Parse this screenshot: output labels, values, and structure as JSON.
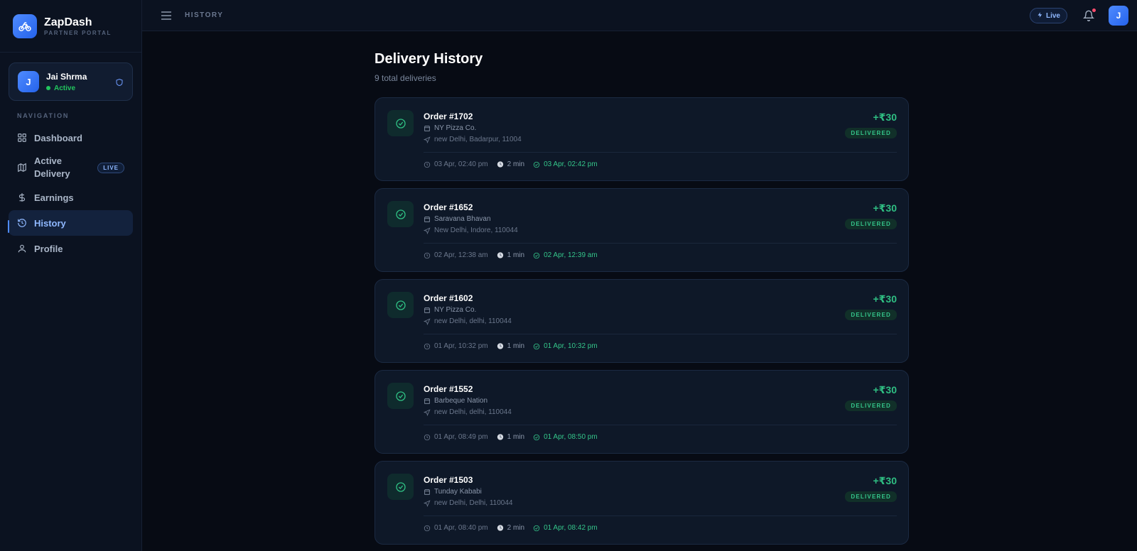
{
  "brand": {
    "name": "ZapDash",
    "subtitle": "PARTNER PORTAL"
  },
  "user": {
    "initial": "J",
    "name": "Jai Shrma",
    "status": "Active"
  },
  "nav": {
    "title": "NAVIGATION",
    "items": [
      {
        "label": "Dashboard",
        "icon": "grid-icon"
      },
      {
        "label": "Active Delivery",
        "icon": "map-icon",
        "badge": "LIVE"
      },
      {
        "label": "Earnings",
        "icon": "dollar-icon"
      },
      {
        "label": "History",
        "icon": "history-icon",
        "active": true
      },
      {
        "label": "Profile",
        "icon": "user-icon"
      }
    ]
  },
  "topbar": {
    "breadcrumb": "HISTORY",
    "live_label": "Live",
    "avatar_initial": "J"
  },
  "page": {
    "title": "Delivery History",
    "subtitle": "9 total deliveries"
  },
  "orders": [
    {
      "id": "Order #1702",
      "restaurant": "NY Pizza Co.",
      "address": "new Delhi, Badarpur, 11004",
      "amount": "+₹30",
      "status": "DELIVERED",
      "picked": "03 Apr, 02:40 pm",
      "duration": "2 min",
      "delivered": "03 Apr, 02:42 pm"
    },
    {
      "id": "Order #1652",
      "restaurant": "Saravana Bhavan",
      "address": "New Delhi, Indore, 110044",
      "amount": "+₹30",
      "status": "DELIVERED",
      "picked": "02 Apr, 12:38 am",
      "duration": "1 min",
      "delivered": "02 Apr, 12:39 am"
    },
    {
      "id": "Order #1602",
      "restaurant": "NY Pizza Co.",
      "address": "new Delhi, delhi, 110044",
      "amount": "+₹30",
      "status": "DELIVERED",
      "picked": "01 Apr, 10:32 pm",
      "duration": "1 min",
      "delivered": "01 Apr, 10:32 pm"
    },
    {
      "id": "Order #1552",
      "restaurant": "Barbeque Nation",
      "address": "new Delhi, delhi, 110044",
      "amount": "+₹30",
      "status": "DELIVERED",
      "picked": "01 Apr, 08:49 pm",
      "duration": "1 min",
      "delivered": "01 Apr, 08:50 pm"
    },
    {
      "id": "Order #1503",
      "restaurant": "Tunday Kababi",
      "address": "new Delhi, Delhi, 110044",
      "amount": "+₹30",
      "status": "DELIVERED",
      "picked": "01 Apr, 08:40 pm",
      "duration": "2 min",
      "delivered": "01 Apr, 08:42 pm"
    }
  ],
  "colors": {
    "accent": "#4f8bff",
    "success": "#2fbf83",
    "background": "#070b14",
    "card": "#0e1828"
  }
}
